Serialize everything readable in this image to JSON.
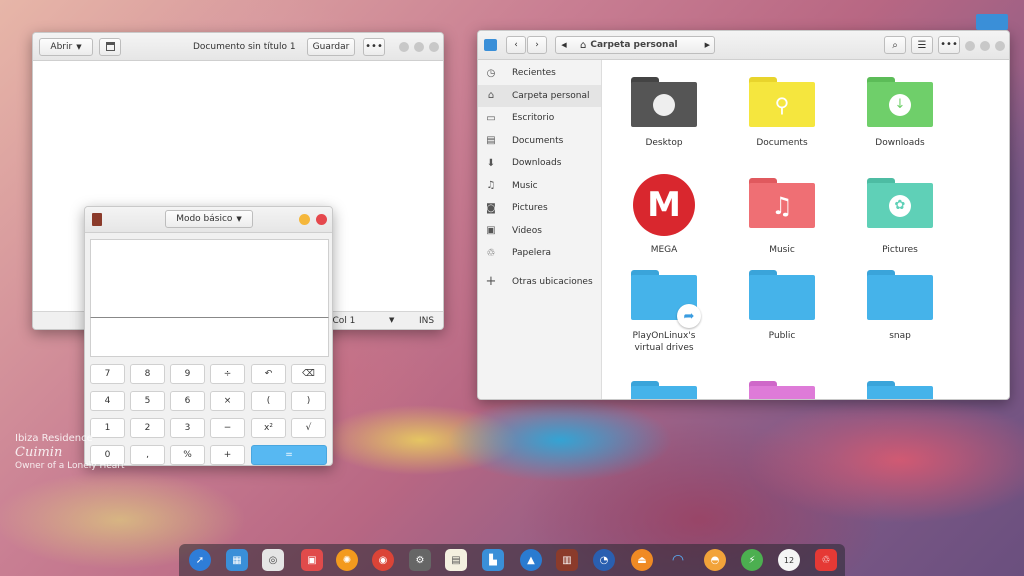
{
  "editor": {
    "open_label": "Abrir",
    "title": "Documento sin título 1",
    "save_label": "Guardar",
    "status_position": "Lín 1, Col 1",
    "status_mode": "INS"
  },
  "calculator": {
    "mode_label": "Modo básico",
    "keys": [
      "7",
      "8",
      "9",
      "÷",
      "↶",
      "⌫",
      "4",
      "5",
      "6",
      "×",
      "(",
      ")",
      "1",
      "2",
      "3",
      "−",
      "x²",
      "√",
      "0",
      ",",
      "%",
      "+",
      "="
    ]
  },
  "files": {
    "location": "Carpeta personal",
    "sidebar": [
      "Recientes",
      "Carpeta personal",
      "Escritorio",
      "Documents",
      "Downloads",
      "Music",
      "Pictures",
      "Videos",
      "Papelera",
      "Otras ubicaciones"
    ],
    "folders": [
      "Desktop",
      "Documents",
      "Downloads",
      "MEGA",
      "Music",
      "Pictures",
      "PlayOnLinux's virtual drives",
      "Public",
      "snap"
    ]
  },
  "watermark": {
    "line1": "Ibiza Residence",
    "line3": "Owner of a Lonely Heart"
  },
  "colors": {
    "accent": "#57b8f2",
    "folder_blue": "#45b3ea",
    "folder_yellow": "#f5e63e",
    "folder_green": "#6fcf6a",
    "folder_dark": "#555555",
    "folder_red": "#ef6f74",
    "folder_teal": "#5fd0b7",
    "folder_pink": "#de7bd8",
    "mega_red": "#d9272e"
  }
}
